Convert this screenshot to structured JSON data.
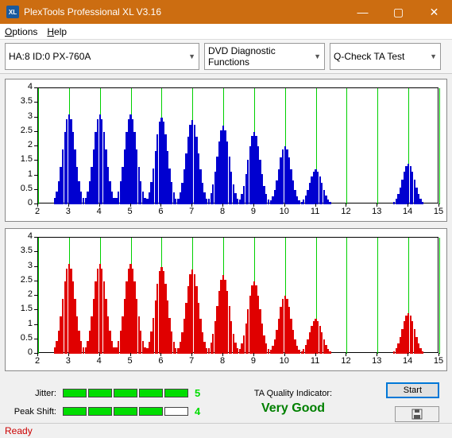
{
  "window": {
    "title": "PlexTools Professional XL V3.16"
  },
  "menu": {
    "options": "Options",
    "help": "Help"
  },
  "toolbar": {
    "device": "HA:8 ID:0   PX-760A",
    "func": "DVD Diagnostic Functions",
    "test": "Q-Check TA Test"
  },
  "chart_data": [
    {
      "type": "bar",
      "color": "#0000d0",
      "xlim": [
        2,
        15
      ],
      "ylim": [
        0,
        4
      ],
      "xticks": [
        2,
        3,
        4,
        5,
        6,
        7,
        8,
        9,
        10,
        11,
        12,
        13,
        14,
        15
      ],
      "yticks": [
        0,
        0.5,
        1,
        1.5,
        2,
        2.5,
        3,
        3.5,
        4
      ],
      "peaks": [
        {
          "center": 3,
          "height": 3.1
        },
        {
          "center": 4,
          "height": 3.1
        },
        {
          "center": 5,
          "height": 3.1
        },
        {
          "center": 6,
          "height": 3.0
        },
        {
          "center": 7,
          "height": 2.9
        },
        {
          "center": 8,
          "height": 2.7
        },
        {
          "center": 9,
          "height": 2.5
        },
        {
          "center": 10,
          "height": 2.0
        },
        {
          "center": 11,
          "height": 1.2
        },
        {
          "center": 14,
          "height": 1.4
        }
      ]
    },
    {
      "type": "bar",
      "color": "#e00000",
      "xlim": [
        2,
        15
      ],
      "ylim": [
        0,
        4
      ],
      "xticks": [
        2,
        3,
        4,
        5,
        6,
        7,
        8,
        9,
        10,
        11,
        12,
        13,
        14,
        15
      ],
      "yticks": [
        0,
        0.5,
        1,
        1.5,
        2,
        2.5,
        3,
        3.5,
        4
      ],
      "peaks": [
        {
          "center": 3,
          "height": 3.1
        },
        {
          "center": 4,
          "height": 3.1
        },
        {
          "center": 5,
          "height": 3.1
        },
        {
          "center": 6,
          "height": 3.0
        },
        {
          "center": 7,
          "height": 2.9
        },
        {
          "center": 8,
          "height": 2.7
        },
        {
          "center": 9,
          "height": 2.5
        },
        {
          "center": 10,
          "height": 2.0
        },
        {
          "center": 11,
          "height": 1.2
        },
        {
          "center": 14,
          "height": 1.4
        }
      ]
    }
  ],
  "metrics": {
    "jitter_label": "Jitter:",
    "jitter_segs": 5,
    "jitter_max": 5,
    "jitter_val": "5",
    "peak_label": "Peak Shift:",
    "peak_segs": 4,
    "peak_max": 5,
    "peak_val": "4",
    "ta_label": "TA Quality Indicator:",
    "ta_value": "Very Good",
    "start": "Start"
  },
  "status": "Ready"
}
